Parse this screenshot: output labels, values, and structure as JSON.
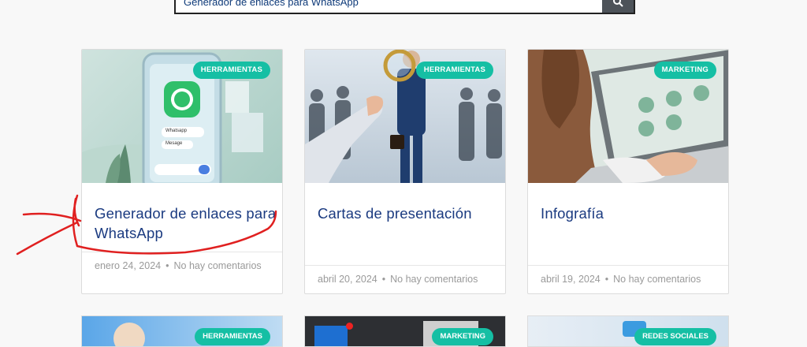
{
  "search": {
    "value": "Generador de enlaces para WhatsApp",
    "button_icon": "search-icon"
  },
  "cards": [
    {
      "category": "HERRAMIENTAS",
      "title": "Generador de enlaces para WhatsApp",
      "date": "enero 24, 2024",
      "comments": "No hay comentarios",
      "sep": "•"
    },
    {
      "category": "HERRAMIENTAS",
      "title": "Cartas de presentación",
      "date": "abril 20, 2024",
      "comments": "No hay comentarios",
      "sep": "•"
    },
    {
      "category": "MARKETING",
      "title": "Infografía",
      "date": "abril 19, 2024",
      "comments": "No hay comentarios",
      "sep": "•"
    }
  ],
  "next_row": [
    {
      "category": "HERRAMIENTAS"
    },
    {
      "category": "MARKETING"
    },
    {
      "category": "REDES SOCIALES"
    }
  ],
  "colors": {
    "accent": "#15bfa4",
    "title": "#1a3a80",
    "annotation": "#e02020"
  },
  "card1_image": {
    "chat_label": "Whatsapp",
    "message_label": "Mesage"
  }
}
